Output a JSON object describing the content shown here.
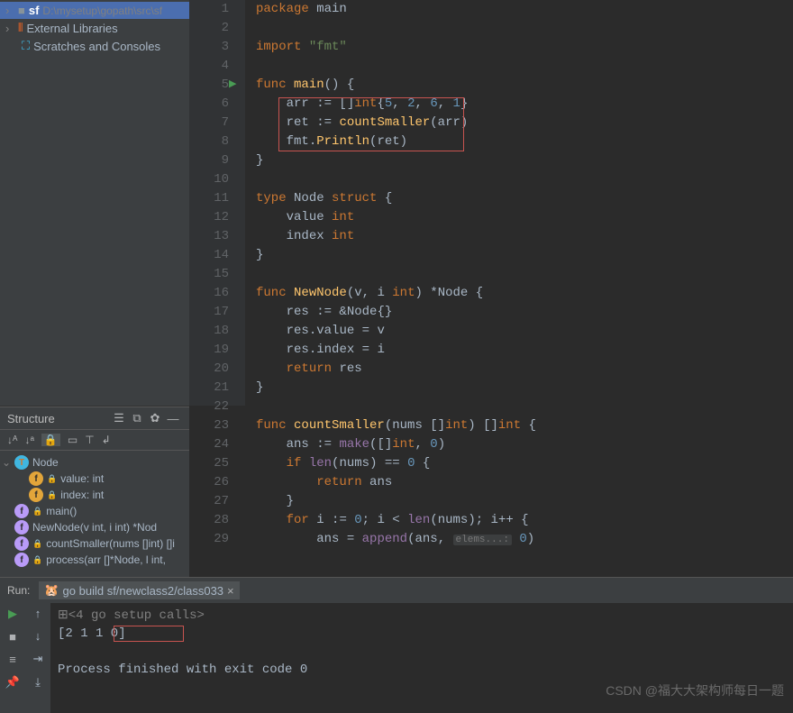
{
  "project": {
    "root_name": "sf",
    "root_path": "D:\\mysetup\\gopath\\src\\sf",
    "external_libs": "External Libraries",
    "scratches": "Scratches and Consoles"
  },
  "structure": {
    "title": "Structure",
    "items": [
      {
        "kind": "type",
        "name": "Node",
        "locked": false,
        "lvl": 1,
        "expanded": true
      },
      {
        "kind": "field",
        "name": "value: int",
        "locked": true,
        "lvl": 2
      },
      {
        "kind": "field",
        "name": "index: int",
        "locked": true,
        "lvl": 2
      },
      {
        "kind": "func",
        "name": "main()",
        "locked": true,
        "lvl": 1
      },
      {
        "kind": "func",
        "name": "NewNode(v int, i int) *Nod",
        "locked": false,
        "lvl": 1
      },
      {
        "kind": "func",
        "name": "countSmaller(nums []int) []i",
        "locked": true,
        "lvl": 1
      },
      {
        "kind": "func",
        "name": "process(arr []*Node, l int, ",
        "locked": true,
        "lvl": 1
      }
    ]
  },
  "code_lines": [
    {
      "n": 1,
      "html": "<span class='kw'>package</span> <span class='ident'>main</span>"
    },
    {
      "n": 2,
      "html": ""
    },
    {
      "n": 3,
      "html": "<span class='kw'>import</span> <span class='str'>\"fmt\"</span>"
    },
    {
      "n": 4,
      "html": ""
    },
    {
      "n": 5,
      "html": "<span class='kw'>func</span> <span class='fn'>main</span>() {"
    },
    {
      "n": 6,
      "html": "    <span class='ident'>arr</span> := []<span class='type'>int</span>{<span class='num'>5</span>, <span class='num'>2</span>, <span class='num'>6</span>, <span class='num'>1</span>}"
    },
    {
      "n": 7,
      "html": "    <span class='ident'>ret</span> := <span class='fn'>countSmaller</span>(<span class='ident'>arr</span>)"
    },
    {
      "n": 8,
      "html": "    <span class='ident'>fmt</span>.<span class='fn'>Println</span>(<span class='ident'>ret</span>)"
    },
    {
      "n": 9,
      "html": "}"
    },
    {
      "n": 10,
      "html": ""
    },
    {
      "n": 11,
      "html": "<span class='kw'>type</span> <span class='ident'>Node</span> <span class='kw'>struct</span> {"
    },
    {
      "n": 12,
      "html": "    <span class='ident'>value</span> <span class='type'>int</span>"
    },
    {
      "n": 13,
      "html": "    <span class='ident'>index</span> <span class='type'>int</span>"
    },
    {
      "n": 14,
      "html": "}"
    },
    {
      "n": 15,
      "html": ""
    },
    {
      "n": 16,
      "html": "<span class='kw'>func</span> <span class='fn'>NewNode</span>(<span class='ident'>v</span>, <span class='ident'>i</span> <span class='type'>int</span>) *<span class='ident'>Node</span> {"
    },
    {
      "n": 17,
      "html": "    <span class='ident'>res</span> := &amp;<span class='ident'>Node</span>{}"
    },
    {
      "n": 18,
      "html": "    <span class='ident'>res</span>.<span class='ident'>value</span> = <span class='ident'>v</span>"
    },
    {
      "n": 19,
      "html": "    <span class='ident'>res</span>.<span class='ident'>index</span> = <span class='ident'>i</span>"
    },
    {
      "n": 20,
      "html": "    <span class='kw'>return</span> <span class='ident'>res</span>"
    },
    {
      "n": 21,
      "html": "}"
    },
    {
      "n": 22,
      "html": ""
    },
    {
      "n": 23,
      "html": "<span class='kw'>func</span> <span class='fn'>countSmaller</span>(<span class='ident'>nums</span> []<span class='type'>int</span>) []<span class='type'>int</span> {"
    },
    {
      "n": 24,
      "html": "    <span class='ident'>ans</span> := <span class='builtin'>make</span>([]<span class='type'>int</span>, <span class='num'>0</span>)"
    },
    {
      "n": 25,
      "html": "    <span class='kw'>if</span> <span class='builtin'>len</span>(<span class='ident'>nums</span>) == <span class='num'>0</span> {"
    },
    {
      "n": 26,
      "html": "        <span class='kw'>return</span> <span class='ident'>ans</span>"
    },
    {
      "n": 27,
      "html": "    }"
    },
    {
      "n": 28,
      "html": "    <span class='kw'>for</span> <span class='ident'>i</span> := <span class='num'>0</span>; <span class='ident'>i</span> &lt; <span class='builtin'>len</span>(<span class='ident'>nums</span>); <span class='ident'>i</span>++ {"
    },
    {
      "n": 29,
      "html": "        <span class='ident'>ans</span> = <span class='builtin'>append</span>(<span class='ident'>ans</span>, <span class='param-hint'>elems...:</span> <span class='num'>0</span>)"
    }
  ],
  "run": {
    "label": "Run:",
    "tab_name": "go build sf/newclass2/class033",
    "setup_line": "<4 go setup calls>",
    "output_line": "[2 1 1 0]",
    "exit_line": "Process finished with exit code 0"
  },
  "watermark": "CSDN @福大大架构师每日一题"
}
